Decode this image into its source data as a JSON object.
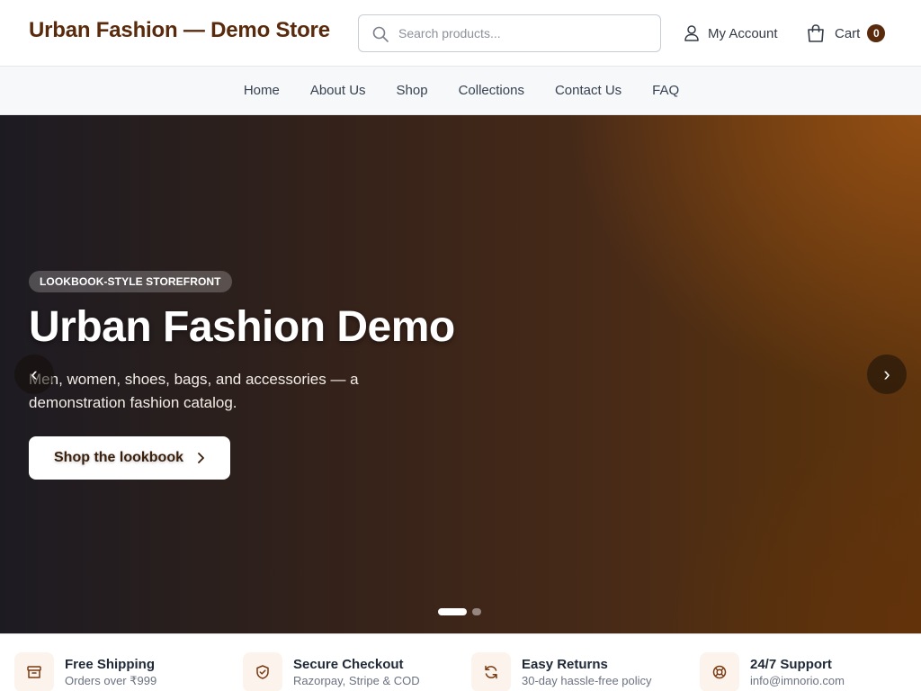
{
  "header": {
    "brand": "Urban Fashion — Demo Store",
    "search_placeholder": "Search products...",
    "account_label": "My Account",
    "cart_label": "Cart",
    "cart_count": "0"
  },
  "nav": {
    "items": [
      "Home",
      "About Us",
      "Shop",
      "Collections",
      "Contact Us",
      "FAQ"
    ]
  },
  "hero": {
    "tag": "LOOKBOOK-STYLE STOREFRONT",
    "title": "Urban Fashion Demo",
    "subtitle": "Men, women, shoes, bags, and accessories — a demonstration fashion catalog.",
    "button_label": "Shop the lookbook",
    "prev_arrow": "‹",
    "next_arrow": "›",
    "slides": {
      "current": 1,
      "total": 2
    }
  },
  "features": [
    {
      "title": "Free Shipping",
      "sub": "Orders over ₹999",
      "icon": "box-icon"
    },
    {
      "title": "Secure Checkout",
      "sub": "Razorpay, Stripe & COD",
      "icon": "shield-check-icon"
    },
    {
      "title": "Easy Returns",
      "sub": "30-day hassle-free policy",
      "icon": "refresh-icon"
    },
    {
      "title": "24/7 Support",
      "sub": "info@imnorio.com",
      "icon": "lifebuoy-icon"
    }
  ],
  "colors": {
    "brand": "#5a2a0c",
    "accent_bg": "#fcf4ec",
    "icon_accent": "#7a3a12"
  }
}
